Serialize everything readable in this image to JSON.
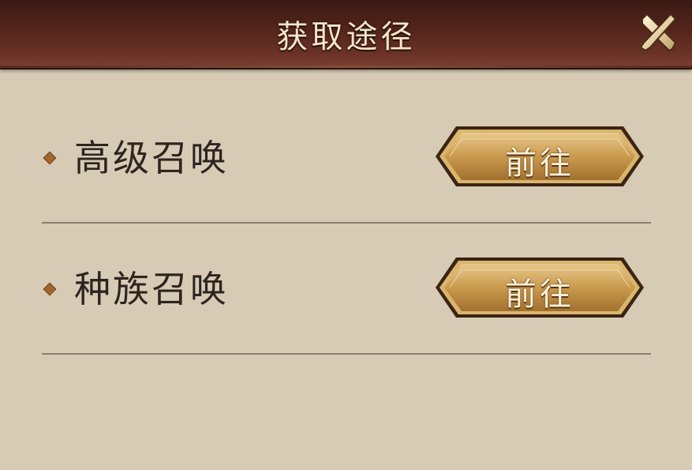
{
  "dialog": {
    "title": "获取途径",
    "close_icon": "close-icon"
  },
  "sources": [
    {
      "label": "高级召唤",
      "button_label": "前往"
    },
    {
      "label": "种族召唤",
      "button_label": "前往"
    }
  ],
  "colors": {
    "header": "#55251c",
    "background": "#d8cbb6",
    "button_gold": "#c99a4e",
    "label_text": "#2e2520",
    "divider": "#8c7f70"
  }
}
